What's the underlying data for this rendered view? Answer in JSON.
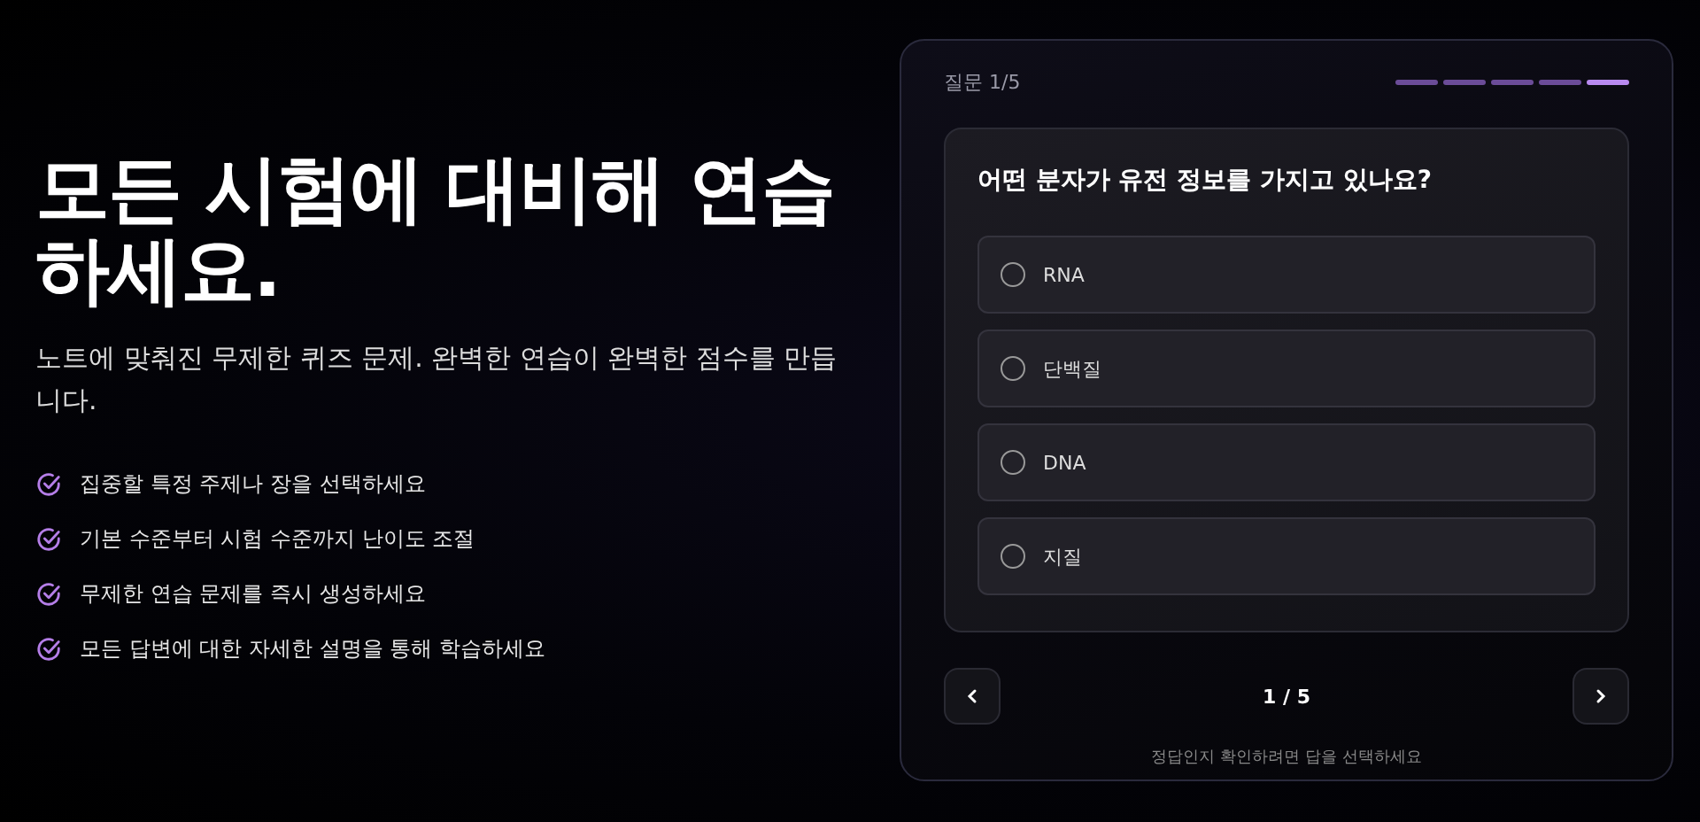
{
  "hero": {
    "title": "모든 시험에 대비해 연습하세요.",
    "subtitle": "노트에 맞춰진 무제한 퀴즈 문제. 완벽한 연습이 완벽한 점수를 만듭니다.",
    "features": [
      "집중할 특정 주제나 장을 선택하세요",
      "기본 수준부터 시험 수준까지 난이도 조절",
      "무제한 연습 문제를 즉시 생성하세요",
      "모든 답변에 대한 자세한 설명을 통해 학습하세요"
    ]
  },
  "quiz": {
    "counter": "질문 1/5",
    "steps": [
      {
        "current": false
      },
      {
        "current": false
      },
      {
        "current": false
      },
      {
        "current": false
      },
      {
        "current": true
      }
    ],
    "question": "어떤 분자가 유전 정보를 가지고 있나요?",
    "options": [
      {
        "label": "RNA",
        "selected": false
      },
      {
        "label": "단백질",
        "selected": false
      },
      {
        "label": "DNA",
        "selected": false
      },
      {
        "label": "지질",
        "selected": false
      }
    ],
    "page": "1 / 5",
    "hint": "정답인지 확인하려면 답을 선택하세요"
  }
}
